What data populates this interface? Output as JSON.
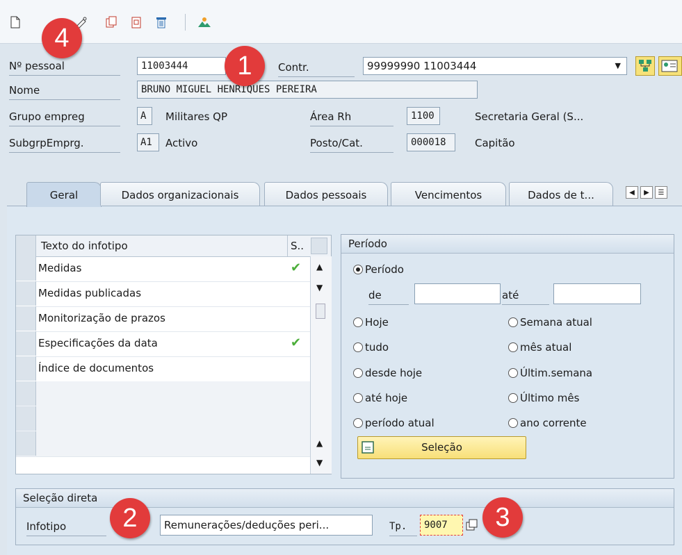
{
  "toolbar": {
    "icons": [
      "new-document-icon",
      "display-icon",
      "change-icon",
      "copy-icon",
      "delimit-icon",
      "delete-icon",
      "overview-icon"
    ]
  },
  "markers": {
    "m1": "1",
    "m2": "2",
    "m3": "3",
    "m4": "4"
  },
  "header": {
    "personnel_label": "Nº pessoal",
    "personnel_value": "11003444",
    "contract_label": "Contr.",
    "contract_value": "99999990 11003444",
    "name_label": "Nome",
    "name_value": "BRUNO MIGUEL HENRIQUES PEREIRA",
    "group_label": "Grupo empreg",
    "group_code": "A",
    "group_text": "Militares QP",
    "area_label": "Área Rh",
    "area_code": "1100",
    "area_text": "Secretaria Geral (S...",
    "subgroup_label": "SubgrpEmprg.",
    "subgroup_code": "A1",
    "subgroup_text": "Activo",
    "post_label": "Posto/Cat.",
    "post_code": "000018",
    "post_text": "Capitão"
  },
  "tabs": [
    {
      "label": "Geral"
    },
    {
      "label": "Dados organizacionais"
    },
    {
      "label": "Dados pessoais"
    },
    {
      "label": "Vencimentos"
    },
    {
      "label": "Dados de t..."
    }
  ],
  "infotype_table": {
    "col_text": "Texto do infotipo",
    "col_status": "S..",
    "rows": [
      {
        "label": "Medidas",
        "status": "✔"
      },
      {
        "label": "Medidas publicadas",
        "status": ""
      },
      {
        "label": "Monitorização de prazos",
        "status": ""
      },
      {
        "label": "Especificações da data",
        "status": "✔"
      },
      {
        "label": "Índice de documentos",
        "status": ""
      }
    ]
  },
  "period": {
    "title": "Período",
    "option_period": "Período",
    "from_label": "de",
    "to_label": "até",
    "from_value": "",
    "to_value": "",
    "options_left": [
      "Hoje",
      "tudo",
      "desde hoje",
      "até hoje",
      "período atual"
    ],
    "options_right": [
      "Semana atual",
      "mês atual",
      "Últim.semana",
      "Último mês",
      "ano corrente"
    ],
    "select_button": "Seleção"
  },
  "direct_selection": {
    "title": "Seleção direta",
    "infotype_label": "Infotipo",
    "infotype_value": "Remunerações/deduções peri...",
    "type_label": "Tp.",
    "type_value": "9007"
  },
  "colors": {
    "marker": "#e23b3b",
    "check": "#4cae3a",
    "button": "#f8df78",
    "highlight_field": "#fff7b0"
  }
}
